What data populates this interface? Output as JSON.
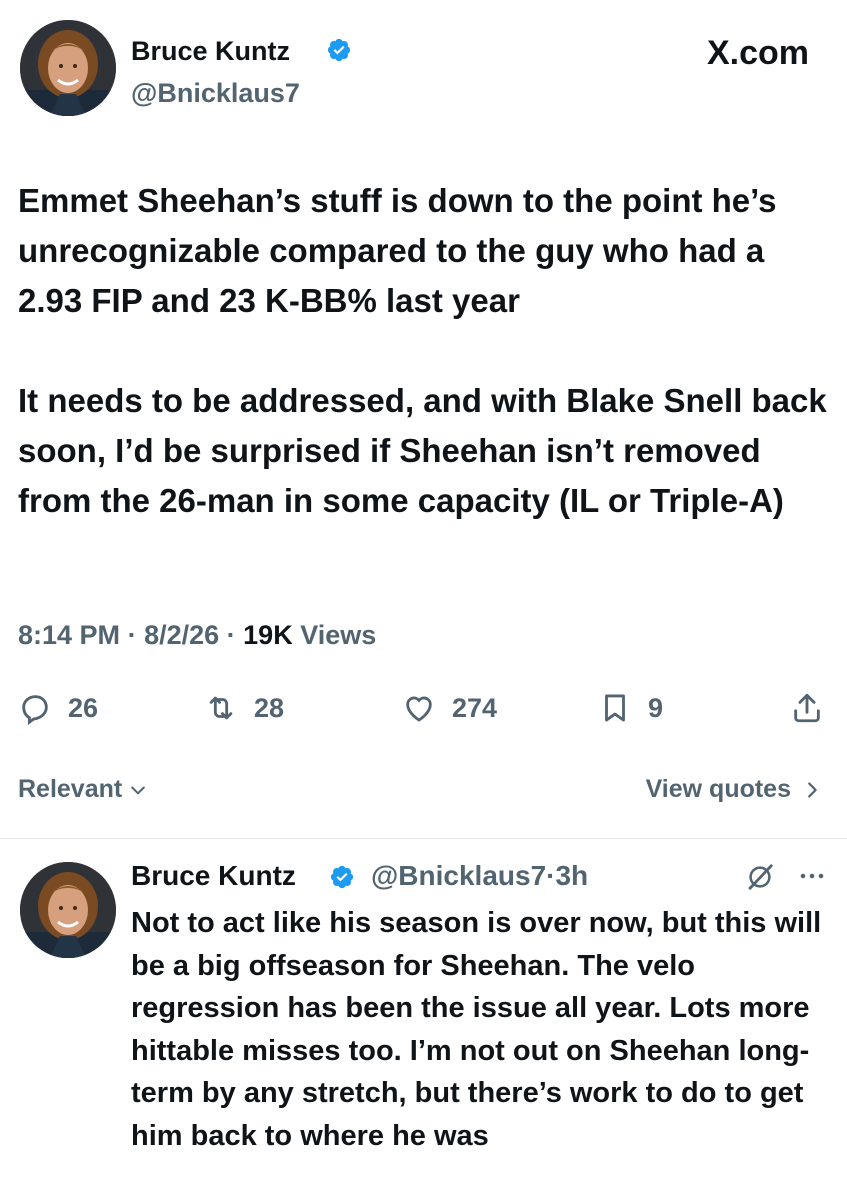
{
  "main_tweet": {
    "author": {
      "display_name": "Bruce Kuntz",
      "handle": "@Bnicklaus7",
      "verified": true,
      "avatar_icon": "profile-photo"
    },
    "watermark": "X.com",
    "body": [
      "Emmet Sheehan’s stuff is down to the point he’s unrecognizable compared to the guy who had a 2.93 FIP and 23 K-BB% last year",
      "It needs to be addressed, and with Blake Snell back soon, I’d be surprised if Sheehan isn’t removed from the 26-man in some capacity (IL or Triple-A)"
    ],
    "meta": {
      "time": "8:14 PM",
      "date": "8/2/26",
      "views_count": "19K",
      "views_label": "Views"
    },
    "actions": {
      "replies": "26",
      "reposts": "28",
      "likes": "274",
      "bookmarks": "9"
    }
  },
  "filters": {
    "sort_label": "Relevant",
    "view_quotes_label": "View quotes"
  },
  "reply_tweet": {
    "author": {
      "display_name": "Bruce Kuntz",
      "handle": "@Bnicklaus7",
      "separator": "·",
      "time_ago": "3h",
      "verified": true
    },
    "body": "Not to act like his season is over now, but this will be a big offseason for Sheehan. The velo regression has been the issue all year. Lots more hittable misses too. I’m not out on Sheehan long-term by any stretch, but there’s work to do to get him back to where he was"
  },
  "colors": {
    "text_primary": "#0f1419",
    "text_secondary": "#536471",
    "verified_blue": "#1d9bf0",
    "divider": "#e6e9eb"
  }
}
